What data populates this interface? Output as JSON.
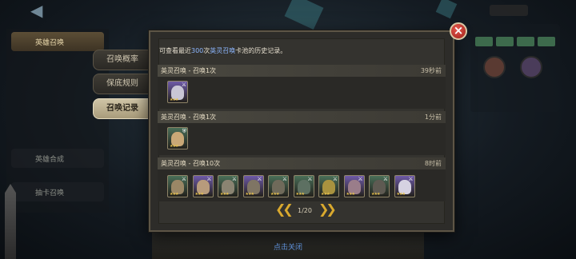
{
  "side_tabs": [
    {
      "label": "召唤概率"
    },
    {
      "label": "保底规则"
    },
    {
      "label": "召唤记录"
    }
  ],
  "background": {
    "left_menu": [
      {
        "label": "英雄召唤",
        "active": true
      },
      {
        "label": "英雄合成",
        "active": false
      },
      {
        "label": "抽卡召唤",
        "active": false
      }
    ]
  },
  "info": {
    "prefix": "可查看最近",
    "count": "300",
    "middle": "次",
    "pool_name": "英灵召唤",
    "suffix": "卡池的历史记录。"
  },
  "records": [
    {
      "label": "英灵召唤 - 召唤1次",
      "time": "39秒前",
      "heroes": [
        {
          "icon": "hero-portrait-icon",
          "bg": "#6e5aa8",
          "face": "#c9c6d6",
          "tag": "⚔",
          "stars": "★★★"
        }
      ]
    },
    {
      "label": "英灵召唤 - 召唤1次",
      "time": "1分前",
      "heroes": [
        {
          "icon": "hero-portrait-icon",
          "bg": "#4a6f58",
          "face": "#c9a877",
          "tag": "⛨",
          "stars": "★★★"
        }
      ]
    },
    {
      "label": "英灵召唤 - 召唤10次",
      "time": "8时前",
      "heroes": [
        {
          "icon": "hero-portrait-icon",
          "bg": "#4a6f58",
          "face": "#9a8766",
          "tag": "⚔",
          "stars": "★★★"
        },
        {
          "icon": "hero-portrait-icon",
          "bg": "#6e5aa8",
          "face": "#b79b7c",
          "tag": "⚔",
          "stars": "★★★"
        },
        {
          "icon": "hero-portrait-icon",
          "bg": "#4a6f58",
          "face": "#8a8472",
          "tag": "⚔",
          "stars": "★★★"
        },
        {
          "icon": "hero-portrait-icon",
          "bg": "#6e5aa8",
          "face": "#7f7564",
          "tag": "⚔",
          "stars": "★★★"
        },
        {
          "icon": "hero-portrait-icon",
          "bg": "#4a6f58",
          "face": "#6f6a5a",
          "tag": "⚔",
          "stars": "★★★"
        },
        {
          "icon": "hero-portrait-icon",
          "bg": "#4a6f58",
          "face": "#5d7062",
          "tag": "⚔",
          "stars": "★★★"
        },
        {
          "icon": "hero-portrait-icon",
          "bg": "#4a6f58",
          "face": "#a8923f",
          "tag": "⚔",
          "stars": "★★★"
        },
        {
          "icon": "hero-portrait-icon",
          "bg": "#6e5aa8",
          "face": "#9a7d8a",
          "tag": "⚔",
          "stars": "★★★"
        },
        {
          "icon": "hero-portrait-icon",
          "bg": "#4a6f58",
          "face": "#5e5a52",
          "tag": "⚔",
          "stars": "★★★"
        },
        {
          "icon": "hero-portrait-icon",
          "bg": "#6e5aa8",
          "face": "#d6d2e2",
          "tag": "⚔",
          "stars": "★★★"
        }
      ]
    }
  ],
  "pager": {
    "text": "1/20",
    "prev_icon": "double-chevron-left-icon",
    "next_icon": "double-chevron-right-icon"
  },
  "close_icon": "close-icon",
  "footer_hint": "点击关闭",
  "colors": {
    "highlight": "#8db7ff",
    "accent_gold": "#d9a92e",
    "close_red": "#c7352b",
    "footer_blue": "#5e8fd6"
  }
}
